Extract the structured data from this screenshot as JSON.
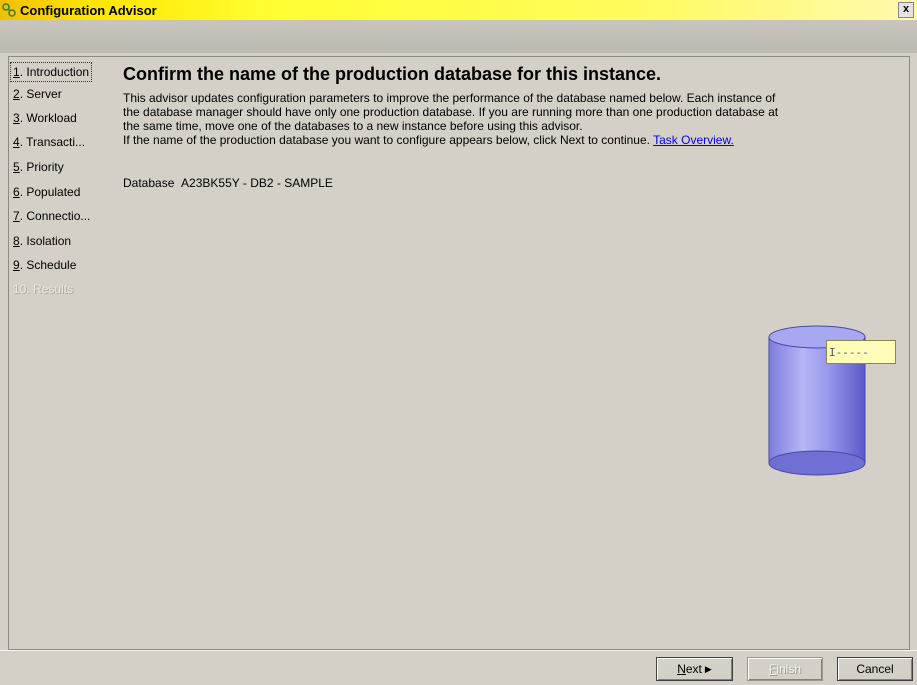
{
  "window": {
    "title": "Configuration Advisor",
    "close_glyph": "x"
  },
  "nav": {
    "items": [
      {
        "num": "1",
        "rest": ". Introduction",
        "state": "selected"
      },
      {
        "num": "2",
        "rest": ". Server",
        "state": "enabled"
      },
      {
        "num": "3",
        "rest": ". Workload",
        "state": "enabled"
      },
      {
        "num": "4",
        "rest": ". Transacti...",
        "state": "enabled"
      },
      {
        "num": "5",
        "rest": ". Priority",
        "state": "enabled"
      },
      {
        "num": "6",
        "rest": ". Populated",
        "state": "enabled"
      },
      {
        "num": "7",
        "rest": ". Connectio...",
        "state": "enabled"
      },
      {
        "num": "8",
        "rest": ". Isolation",
        "state": "enabled"
      },
      {
        "num": "9",
        "rest": ". Schedule",
        "state": "enabled"
      },
      {
        "num": "10",
        "rest": ". Results",
        "state": "disabled"
      }
    ]
  },
  "main": {
    "heading": "Confirm the name of the production database for this instance.",
    "para_lines": [
      "This advisor updates configuration parameters to improve the performance of the database named below. Each instance of",
      "the database manager should have only one production database. If you are running more than one production database at",
      "the same time, move one of the databases to a new instance before using this advisor."
    ],
    "para_last": "If the name of the production database you want to configure appears below, click Next to continue.",
    "link_text": "Task Overview.",
    "database_label": "Database",
    "database_value": "A23BK55Y - DB2 - SAMPLE",
    "tooltip_text": "I-----"
  },
  "buttons": {
    "next": {
      "u": "N",
      "rest": "ext"
    },
    "finish": {
      "u": "F",
      "rest": "inish"
    },
    "cancel": "Cancel"
  },
  "colors": {
    "title_gradient_start": "#f0c000",
    "cylinder": "#8f8fe8",
    "link": "#0000ee"
  }
}
